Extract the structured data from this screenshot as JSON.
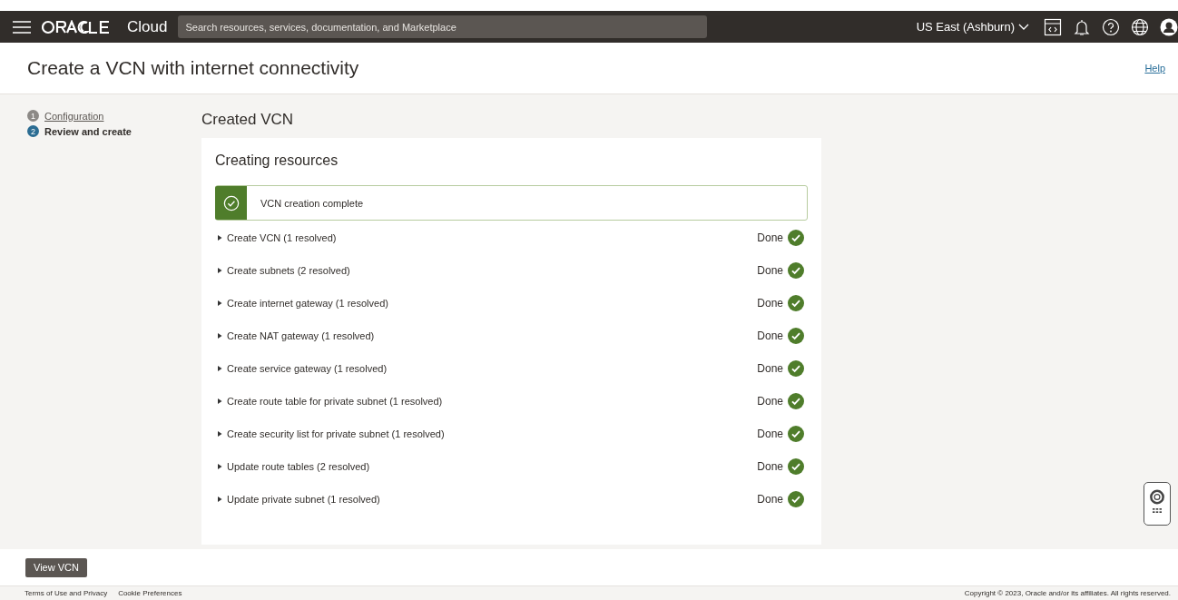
{
  "header": {
    "brand": "Cloud",
    "search": {
      "placeholder": "Search resources, services, documentation, and Marketplace"
    },
    "region": "US East (Ashburn)"
  },
  "page": {
    "title": "Create a VCN with internet connectivity",
    "help": "Help"
  },
  "steps": [
    {
      "number": "1",
      "label": "Configuration",
      "selected": false
    },
    {
      "number": "2",
      "label": "Review and create",
      "selected": true
    }
  ],
  "section_title": "Created VCN",
  "card": {
    "title": "Creating resources",
    "banner": "VCN creation complete",
    "tasks": [
      {
        "label": "Create VCN (1 resolved)",
        "status": "Done",
        "expanded": false
      },
      {
        "label": "Create subnets (2 resolved)",
        "status": "Done",
        "expanded": false
      },
      {
        "label": "Create internet gateway (1 resolved)",
        "status": "Done",
        "expanded": false
      },
      {
        "label": "Create NAT gateway (1 resolved)",
        "status": "Done",
        "expanded": false
      },
      {
        "label": "Create service gateway (1 resolved)",
        "status": "Done",
        "expanded": false
      },
      {
        "label": "Create route table for private subnet (1 resolved)",
        "status": "Done",
        "expanded": false
      },
      {
        "label": "Create security list for private subnet (1 resolved)",
        "status": "Done",
        "expanded": false
      },
      {
        "label": "Update route tables (2 resolved)",
        "status": "Done",
        "expanded": false
      },
      {
        "label": "Update private subnet (1 resolved)",
        "status": "Done",
        "expanded": false
      }
    ]
  },
  "button": "View VCN",
  "footer": {
    "links": [
      "Terms of Use and Privacy",
      "Cookie Preferences"
    ],
    "copyright": "Copyright © 2023, Oracle and/or its affiliates. All rights reserved."
  }
}
